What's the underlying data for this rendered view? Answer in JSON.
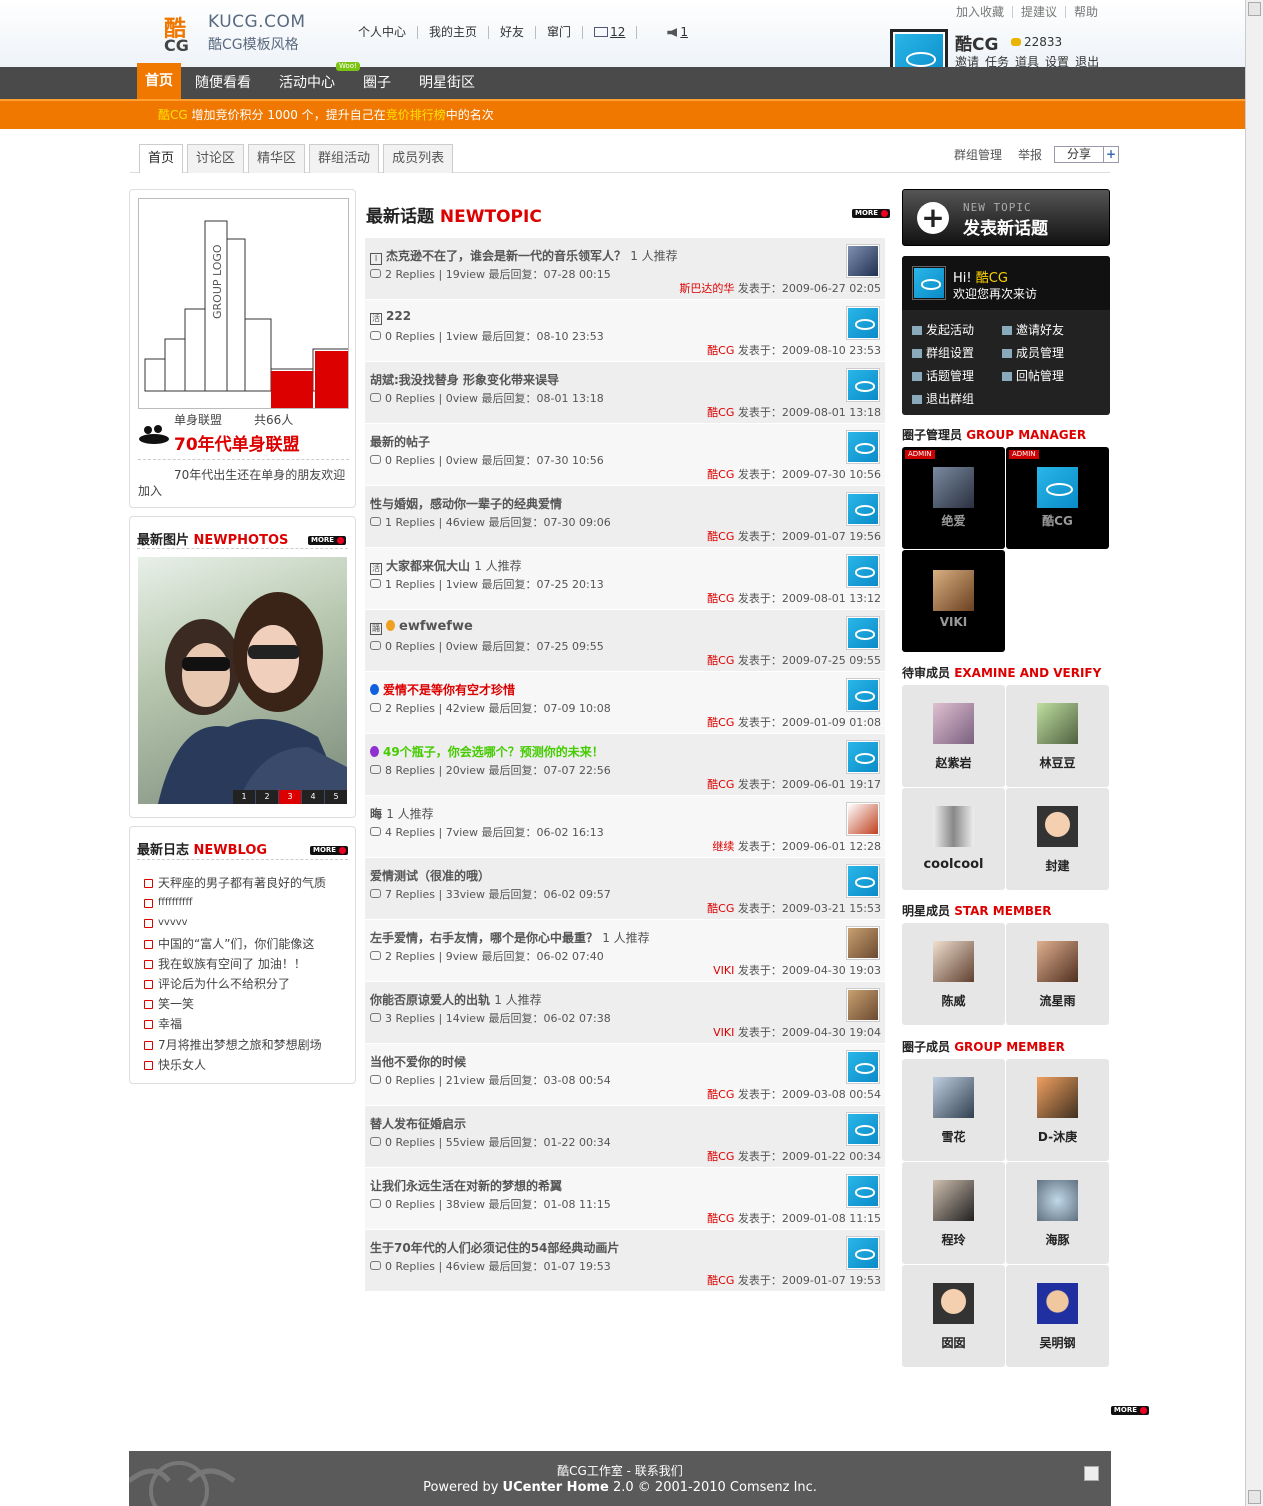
{
  "header": {
    "logo_main": "KUCG.COM",
    "logo_sub": "酷CG模板风格",
    "top_nav": [
      "个人中心",
      "我的主页",
      "好友",
      "窜门"
    ],
    "messages_count": "12",
    "notice_count": "1",
    "top_links": [
      "加入收藏",
      "提建议",
      "帮助"
    ],
    "user_name": "酷CG",
    "user_credit": "22833",
    "user_links": [
      "邀请",
      "任务",
      "道具",
      "设置",
      "退出"
    ]
  },
  "main_nav": {
    "tabs": [
      "首页",
      "随便看看",
      "活动中心",
      "圈子",
      "明星街区"
    ],
    "new_badge": "Woo!"
  },
  "notice_bar": {
    "user": "酷CG",
    "text1": " 增加竞价积分 ",
    "points": "1000 个",
    "text2": "，提升自己在",
    "link": "竞价排行榜",
    "text3": "中的名次"
  },
  "sub_tabs": [
    "首页",
    "讨论区",
    "精华区",
    "群组活动",
    "成员列表"
  ],
  "group_links": [
    "群组管理",
    "举报"
  ],
  "share_label": "分享",
  "group": {
    "category": "单身联盟",
    "member_count": "共66人",
    "name": "70年代单身联盟",
    "desc": "70年代出生还在单身的朋友欢迎加入",
    "logo_text": "GROUP LOGO"
  },
  "photos": {
    "title": "最新图片",
    "title_en": "NEWPHOTOS",
    "pages": [
      "1",
      "2",
      "3",
      "4",
      "5"
    ],
    "more": "MORE"
  },
  "blogs": {
    "title": "最新日志",
    "title_en": "NEWBLOG",
    "more": "MORE",
    "items": [
      "天秤座的男子都有著良好的气质",
      "ffffffffff",
      "vvvvv",
      "中国的“富人”们，你们能像这",
      "我在蚁族有空间了  加油！！",
      "评论后为什么不给积分了",
      "笑一笑",
      "幸福",
      "7月将推出梦想之旅和梦想剧场",
      "快乐女人"
    ]
  },
  "topics": {
    "title": "最新话题",
    "title_en": "NEWTOPIC",
    "more": "MORE",
    "posted_label": "发表于：",
    "items": [
      {
        "title": "杰克逊不在了，谁会是新一代的音乐领军人？",
        "rec": "1 人推荐",
        "meta": "2 Replies | 19view 最后回复：07-28 00:15",
        "author": "斯巴达的华",
        "date": "2009-06-27 02:05",
        "icon": "Ⅰ",
        "style": ""
      },
      {
        "title": "222",
        "rec": "",
        "meta": "0 Replies | 1view 最后回复：08-10 23:53",
        "author": "酷CG",
        "date": "2009-08-10 23:53",
        "icon": "活",
        "style": ""
      },
      {
        "title": "胡斌:我没找替身  形象变化带来误导",
        "rec": "",
        "meta": "0 Replies | 0view 最后回复：08-01 13:18",
        "author": "酷CG",
        "date": "2009-08-01 13:18",
        "icon": "",
        "style": ""
      },
      {
        "title": "最新的帖子",
        "rec": "",
        "meta": "0 Replies | 0view 最后回复：07-30 10:56",
        "author": "酷CG",
        "date": "2009-07-30 10:56",
        "icon": "",
        "style": ""
      },
      {
        "title": "性与婚姻，感动你一辈子的经典爱情",
        "rec": "",
        "meta": "1 Replies | 46view 最后回复：07-30 09:06",
        "author": "酷CG",
        "date": "2009-01-07 19:56",
        "icon": "",
        "style": ""
      },
      {
        "title": "大家都来侃大山",
        "rec": "1 人推荐",
        "meta": "1 Replies | 1view 最后回复：07-25 20:13",
        "author": "酷CG",
        "date": "2009-08-01 13:12",
        "icon": "活",
        "style": ""
      },
      {
        "title": "ewfwefwe",
        "rec": "",
        "meta": "0 Replies | 0view 最后回复：07-25 09:55",
        "author": "酷CG",
        "date": "2009-07-25 09:55",
        "icon": "踊",
        "style": "orange"
      },
      {
        "title": "爱情不是等你有空才珍惜",
        "rec": "",
        "meta": "2 Replies | 42view 最后回复：07-09 10:08",
        "author": "酷CG",
        "date": "2009-01-09 01:08",
        "icon": "",
        "style": "red"
      },
      {
        "title": "49个瓶子，你会选哪个？预测你的未来！",
        "rec": "",
        "meta": "8 Replies | 20view 最后回复：07-07 22:56",
        "author": "酷CG",
        "date": "2009-06-01 19:17",
        "icon": "",
        "style": "green"
      },
      {
        "title": "晦",
        "rec": "1 人推荐",
        "meta": "4 Replies | 7view 最后回复：06-02 16:13",
        "author": "继续",
        "date": "2009-06-01 12:28",
        "icon": "",
        "style": ""
      },
      {
        "title": "爱情测试（很准的哦）",
        "rec": "",
        "meta": "7 Replies | 33view 最后回复：06-02 09:57",
        "author": "酷CG",
        "date": "2009-03-21 15:53",
        "icon": "",
        "style": ""
      },
      {
        "title": "左手爱情，右手友情，哪个是你心中最重？",
        "rec": "1 人推荐",
        "meta": "2 Replies | 9view 最后回复：06-02 07:40",
        "author": "VIKI",
        "date": "2009-04-30 19:03",
        "icon": "",
        "style": ""
      },
      {
        "title": "你能否原谅爱人的出轨",
        "rec": "1 人推荐",
        "meta": "3 Replies | 14view 最后回复：06-02 07:38",
        "author": "VIKI",
        "date": "2009-04-30 19:04",
        "icon": "",
        "style": ""
      },
      {
        "title": "当他不爱你的时候",
        "rec": "",
        "meta": "0 Replies | 21view 最后回复：03-08 00:54",
        "author": "酷CG",
        "date": "2009-03-08 00:54",
        "icon": "",
        "style": ""
      },
      {
        "title": "替人发布征婚启示",
        "rec": "",
        "meta": "0 Replies | 55view 最后回复：01-22 00:34",
        "author": "酷CG",
        "date": "2009-01-22 00:34",
        "icon": "",
        "style": ""
      },
      {
        "title": "让我们永远生活在对新的梦想的希翼",
        "rec": "",
        "meta": "0 Replies | 38view 最后回复：01-08 11:15",
        "author": "酷CG",
        "date": "2009-01-08 11:15",
        "icon": "",
        "style": ""
      },
      {
        "title": "生于70年代的人们必须记住的54部经典动画片",
        "rec": "",
        "meta": "0 Replies | 46view 最后回复：01-07 19:53",
        "author": "酷CG",
        "date": "2009-01-07 19:53",
        "icon": "",
        "style": ""
      }
    ]
  },
  "new_topic_btn": {
    "en": "NEW TOPIC",
    "cn": "发表新话题"
  },
  "welcome": {
    "hi": "Hi!",
    "name": "酷CG",
    "msg": "欢迎您再次来访",
    "actions": [
      "发起活动",
      "邀请好友",
      "群组设置",
      "成员管理",
      "话题管理",
      "回帖管理",
      "退出群组"
    ]
  },
  "managers": {
    "title": "圈子管理员",
    "title_en": "GROUP MANAGER",
    "admin_tag": "ADMIN",
    "items": [
      "绝爱",
      "酷CG",
      "VIKI"
    ]
  },
  "pending": {
    "title": "待审成员",
    "title_en": "EXAMINE AND VERIFY",
    "items": [
      "赵紫岩",
      "林豆豆",
      "coolcool",
      "封建"
    ]
  },
  "stars": {
    "title": "明星成员",
    "title_en": "STAR MEMBER",
    "items": [
      "陈威",
      "流星雨"
    ]
  },
  "members": {
    "title": "圈子成员",
    "title_en": "GROUP MEMBER",
    "items": [
      "雪花",
      "D-沐庚",
      "程玲",
      "海豚",
      "囡囡",
      "吴明钢"
    ],
    "more": "MORE"
  },
  "footer": {
    "line1": "酷CG工作室  - 联系我们",
    "powered": "Powered by ",
    "product": "UCenter Home",
    "rest": " 2.0 © 2001-2010 Comsenz Inc."
  },
  "colors": {
    "accent": "#f07800",
    "nav": "#4a4a4a",
    "red": "#dd0000"
  }
}
